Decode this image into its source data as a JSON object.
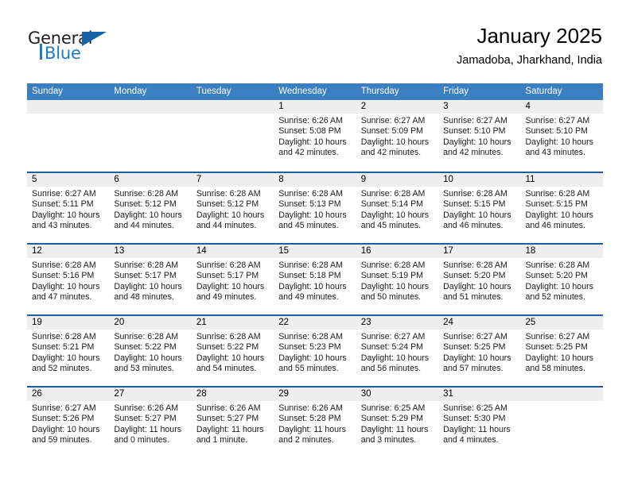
{
  "brand": {
    "word1": "General",
    "word2": "Blue",
    "logo_icon": "triangle-logo-icon"
  },
  "header": {
    "title": "January 2025",
    "subtitle": "Jamadoba, Jharkhand, India"
  },
  "colors": {
    "header_blue": "#3c7fc1",
    "row_divider_blue": "#1f5fa0",
    "daynum_band": "#eeeeee",
    "brand_blue": "#1f7ac4",
    "brand_triangle": "#1464a5"
  },
  "calendar": {
    "weekday_headers": [
      "Sunday",
      "Monday",
      "Tuesday",
      "Wednesday",
      "Thursday",
      "Friday",
      "Saturday"
    ],
    "weeks": [
      [
        {
          "day": "",
          "lines": []
        },
        {
          "day": "",
          "lines": []
        },
        {
          "day": "",
          "lines": []
        },
        {
          "day": "1",
          "lines": [
            "Sunrise: 6:26 AM",
            "Sunset: 5:08 PM",
            "Daylight: 10 hours",
            "and 42 minutes."
          ]
        },
        {
          "day": "2",
          "lines": [
            "Sunrise: 6:27 AM",
            "Sunset: 5:09 PM",
            "Daylight: 10 hours",
            "and 42 minutes."
          ]
        },
        {
          "day": "3",
          "lines": [
            "Sunrise: 6:27 AM",
            "Sunset: 5:10 PM",
            "Daylight: 10 hours",
            "and 42 minutes."
          ]
        },
        {
          "day": "4",
          "lines": [
            "Sunrise: 6:27 AM",
            "Sunset: 5:10 PM",
            "Daylight: 10 hours",
            "and 43 minutes."
          ]
        }
      ],
      [
        {
          "day": "5",
          "lines": [
            "Sunrise: 6:27 AM",
            "Sunset: 5:11 PM",
            "Daylight: 10 hours",
            "and 43 minutes."
          ]
        },
        {
          "day": "6",
          "lines": [
            "Sunrise: 6:28 AM",
            "Sunset: 5:12 PM",
            "Daylight: 10 hours",
            "and 44 minutes."
          ]
        },
        {
          "day": "7",
          "lines": [
            "Sunrise: 6:28 AM",
            "Sunset: 5:12 PM",
            "Daylight: 10 hours",
            "and 44 minutes."
          ]
        },
        {
          "day": "8",
          "lines": [
            "Sunrise: 6:28 AM",
            "Sunset: 5:13 PM",
            "Daylight: 10 hours",
            "and 45 minutes."
          ]
        },
        {
          "day": "9",
          "lines": [
            "Sunrise: 6:28 AM",
            "Sunset: 5:14 PM",
            "Daylight: 10 hours",
            "and 45 minutes."
          ]
        },
        {
          "day": "10",
          "lines": [
            "Sunrise: 6:28 AM",
            "Sunset: 5:15 PM",
            "Daylight: 10 hours",
            "and 46 minutes."
          ]
        },
        {
          "day": "11",
          "lines": [
            "Sunrise: 6:28 AM",
            "Sunset: 5:15 PM",
            "Daylight: 10 hours",
            "and 46 minutes."
          ]
        }
      ],
      [
        {
          "day": "12",
          "lines": [
            "Sunrise: 6:28 AM",
            "Sunset: 5:16 PM",
            "Daylight: 10 hours",
            "and 47 minutes."
          ]
        },
        {
          "day": "13",
          "lines": [
            "Sunrise: 6:28 AM",
            "Sunset: 5:17 PM",
            "Daylight: 10 hours",
            "and 48 minutes."
          ]
        },
        {
          "day": "14",
          "lines": [
            "Sunrise: 6:28 AM",
            "Sunset: 5:17 PM",
            "Daylight: 10 hours",
            "and 49 minutes."
          ]
        },
        {
          "day": "15",
          "lines": [
            "Sunrise: 6:28 AM",
            "Sunset: 5:18 PM",
            "Daylight: 10 hours",
            "and 49 minutes."
          ]
        },
        {
          "day": "16",
          "lines": [
            "Sunrise: 6:28 AM",
            "Sunset: 5:19 PM",
            "Daylight: 10 hours",
            "and 50 minutes."
          ]
        },
        {
          "day": "17",
          "lines": [
            "Sunrise: 6:28 AM",
            "Sunset: 5:20 PM",
            "Daylight: 10 hours",
            "and 51 minutes."
          ]
        },
        {
          "day": "18",
          "lines": [
            "Sunrise: 6:28 AM",
            "Sunset: 5:20 PM",
            "Daylight: 10 hours",
            "and 52 minutes."
          ]
        }
      ],
      [
        {
          "day": "19",
          "lines": [
            "Sunrise: 6:28 AM",
            "Sunset: 5:21 PM",
            "Daylight: 10 hours",
            "and 52 minutes."
          ]
        },
        {
          "day": "20",
          "lines": [
            "Sunrise: 6:28 AM",
            "Sunset: 5:22 PM",
            "Daylight: 10 hours",
            "and 53 minutes."
          ]
        },
        {
          "day": "21",
          "lines": [
            "Sunrise: 6:28 AM",
            "Sunset: 5:22 PM",
            "Daylight: 10 hours",
            "and 54 minutes."
          ]
        },
        {
          "day": "22",
          "lines": [
            "Sunrise: 6:28 AM",
            "Sunset: 5:23 PM",
            "Daylight: 10 hours",
            "and 55 minutes."
          ]
        },
        {
          "day": "23",
          "lines": [
            "Sunrise: 6:27 AM",
            "Sunset: 5:24 PM",
            "Daylight: 10 hours",
            "and 56 minutes."
          ]
        },
        {
          "day": "24",
          "lines": [
            "Sunrise: 6:27 AM",
            "Sunset: 5:25 PM",
            "Daylight: 10 hours",
            "and 57 minutes."
          ]
        },
        {
          "day": "25",
          "lines": [
            "Sunrise: 6:27 AM",
            "Sunset: 5:25 PM",
            "Daylight: 10 hours",
            "and 58 minutes."
          ]
        }
      ],
      [
        {
          "day": "26",
          "lines": [
            "Sunrise: 6:27 AM",
            "Sunset: 5:26 PM",
            "Daylight: 10 hours",
            "and 59 minutes."
          ]
        },
        {
          "day": "27",
          "lines": [
            "Sunrise: 6:26 AM",
            "Sunset: 5:27 PM",
            "Daylight: 11 hours",
            "and 0 minutes."
          ]
        },
        {
          "day": "28",
          "lines": [
            "Sunrise: 6:26 AM",
            "Sunset: 5:27 PM",
            "Daylight: 11 hours",
            "and 1 minute."
          ]
        },
        {
          "day": "29",
          "lines": [
            "Sunrise: 6:26 AM",
            "Sunset: 5:28 PM",
            "Daylight: 11 hours",
            "and 2 minutes."
          ]
        },
        {
          "day": "30",
          "lines": [
            "Sunrise: 6:25 AM",
            "Sunset: 5:29 PM",
            "Daylight: 11 hours",
            "and 3 minutes."
          ]
        },
        {
          "day": "31",
          "lines": [
            "Sunrise: 6:25 AM",
            "Sunset: 5:30 PM",
            "Daylight: 11 hours",
            "and 4 minutes."
          ]
        },
        {
          "day": "",
          "lines": []
        }
      ]
    ]
  }
}
